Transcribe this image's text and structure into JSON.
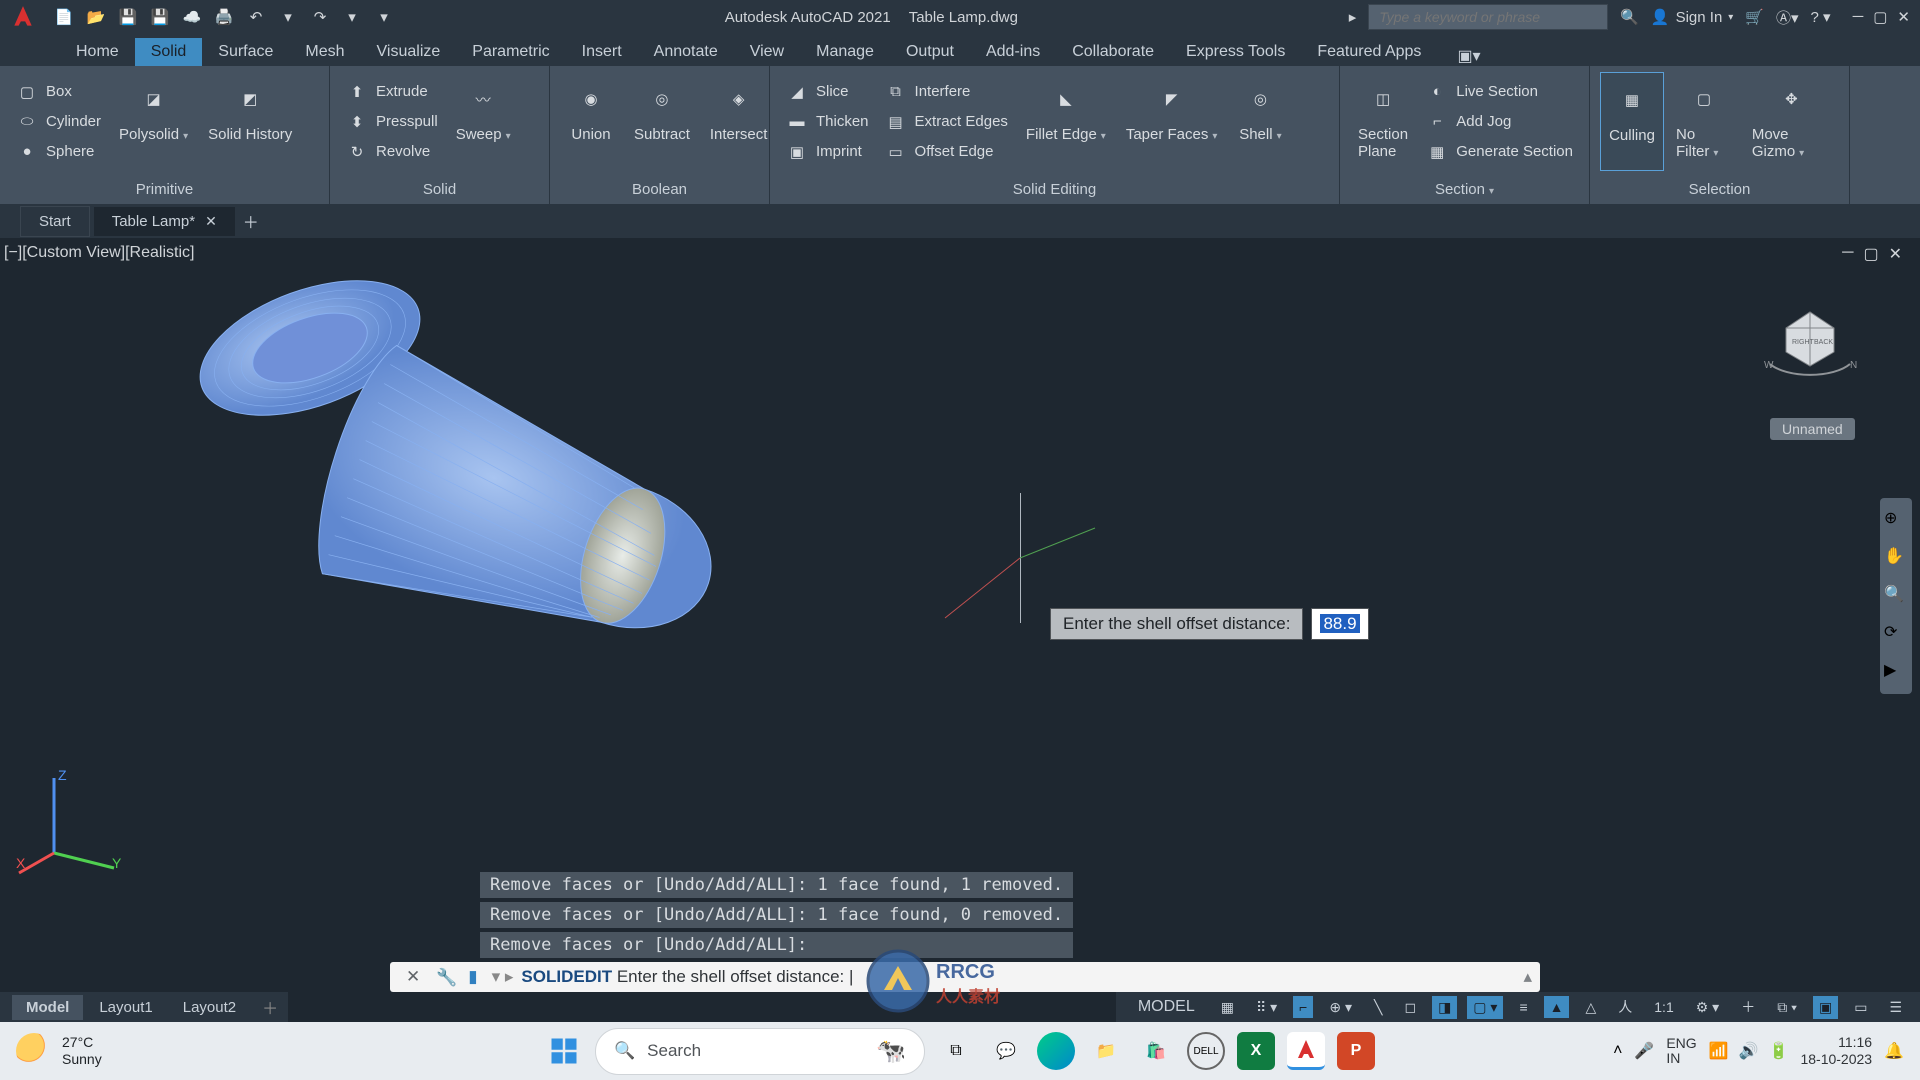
{
  "titlebar": {
    "app": "Autodesk AutoCAD 2021",
    "doc": "Table Lamp.dwg",
    "search_placeholder": "Type a keyword or phrase",
    "signin": "Sign In"
  },
  "ribbon_tabs": [
    "Home",
    "Solid",
    "Surface",
    "Mesh",
    "Visualize",
    "Parametric",
    "Insert",
    "Annotate",
    "View",
    "Manage",
    "Output",
    "Add-ins",
    "Collaborate",
    "Express Tools",
    "Featured Apps"
  ],
  "ribbon_active_tab": "Solid",
  "panels": {
    "primitive": {
      "title": "Primitive",
      "items": [
        "Box",
        "Cylinder",
        "Sphere"
      ],
      "big": [
        "Polysolid",
        "Solid History"
      ]
    },
    "solid": {
      "title": "Solid",
      "items": [
        "Extrude",
        "Presspull",
        "Revolve"
      ],
      "big": [
        "Sweep"
      ]
    },
    "boolean": {
      "title": "Boolean",
      "big": [
        "Union",
        "Subtract",
        "Intersect"
      ]
    },
    "editing": {
      "title": "Solid Editing",
      "left": [
        "Slice",
        "Thicken",
        "Imprint"
      ],
      "left2": [
        "Interfere",
        "Extract Edges",
        "Offset Edge"
      ],
      "big": [
        "Fillet Edge",
        "Taper Faces",
        "Shell"
      ]
    },
    "section": {
      "title": "Section",
      "big": [
        "Section Plane"
      ],
      "items": [
        "Live Section",
        "Add Jog",
        "Generate Section"
      ]
    },
    "selection": {
      "title": "Selection",
      "big": [
        "Culling",
        "No Filter",
        "Move Gizmo"
      ]
    }
  },
  "file_tabs": {
    "start": "Start",
    "doc": "Table Lamp*"
  },
  "viewport": {
    "label": "[−][Custom View][Realistic]",
    "viewcube_label": "Unnamed"
  },
  "dynamic_input": {
    "prompt": "Enter the shell offset distance:",
    "value": "88.9"
  },
  "command_history": [
    "Remove faces or [Undo/Add/ALL]: 1 face found, 1 removed.",
    "Remove faces or [Undo/Add/ALL]: 1 face found, 0 removed.",
    "Remove faces or [Undo/Add/ALL]:"
  ],
  "command_line": {
    "cmd": "SOLIDEDIT",
    "prompt": "Enter the shell offset distance: "
  },
  "layout_tabs": [
    "Model",
    "Layout1",
    "Layout2"
  ],
  "status": {
    "model": "MODEL",
    "scale": "1:1"
  },
  "taskbar": {
    "temp": "27°C",
    "cond": "Sunny",
    "search": "Search",
    "lang1": "ENG",
    "lang2": "IN",
    "time": "11:16",
    "date": "18-10-2023"
  }
}
